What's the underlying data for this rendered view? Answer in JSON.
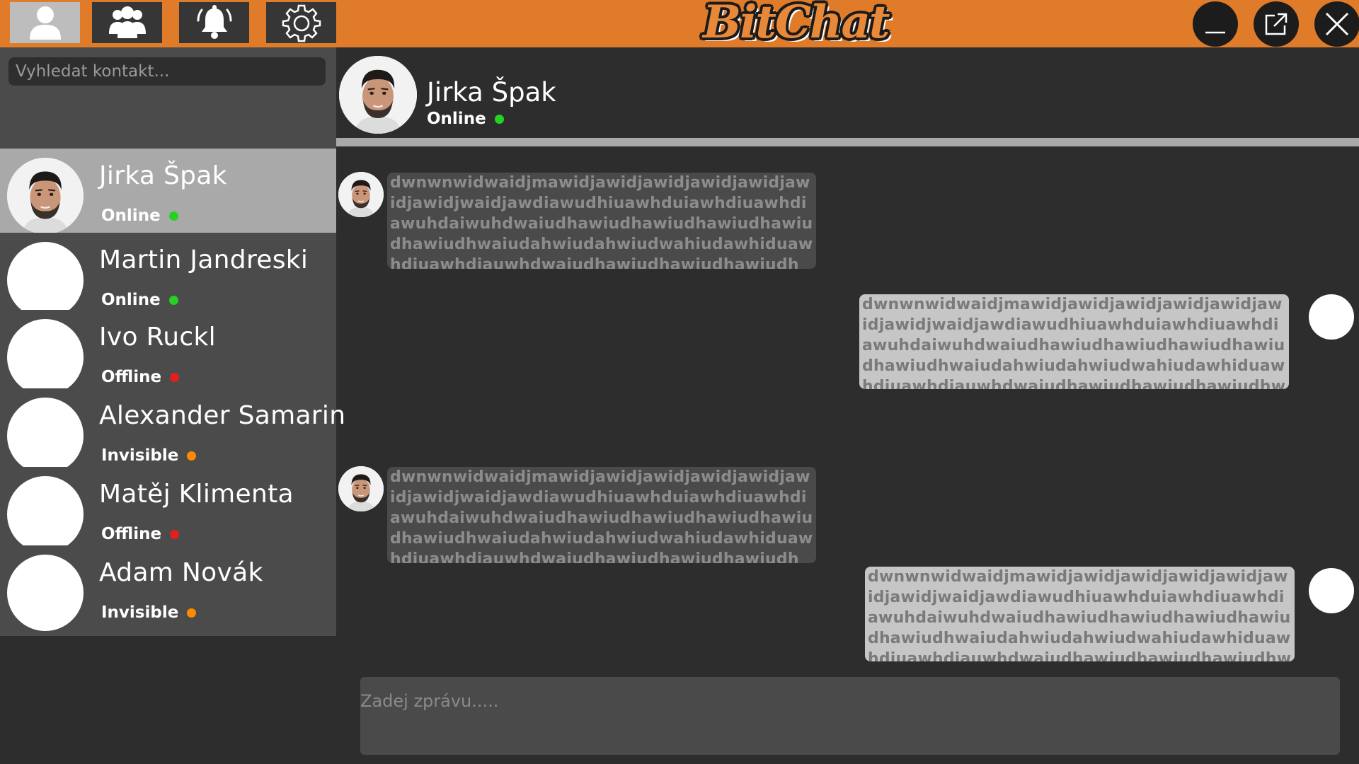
{
  "app": {
    "logo": "BitChat",
    "brand_color": "#e07b2a"
  },
  "topbar": {
    "nav": [
      {
        "icon": "user-icon",
        "active": true
      },
      {
        "icon": "group-icon",
        "active": false
      },
      {
        "icon": "bell-icon",
        "active": false
      },
      {
        "icon": "gear-icon",
        "active": false
      }
    ],
    "window_controls": [
      "minimize-icon",
      "popout-icon",
      "close-icon"
    ]
  },
  "sidebar": {
    "search": {
      "placeholder": "Vyhledat kontakt...",
      "value": ""
    },
    "contacts": [
      {
        "name": "Jirka Špak",
        "status": "Online",
        "status_color": "#22d322",
        "active": true,
        "has_photo": true
      },
      {
        "name": "Martin Jandreski",
        "status": "Online",
        "status_color": "#22d322",
        "active": false,
        "has_photo": false
      },
      {
        "name": "Ivo Ruckl",
        "status": "Offline",
        "status_color": "#e01f1f",
        "active": false,
        "has_photo": false
      },
      {
        "name": "Alexander Samarin",
        "status": "Invisible",
        "status_color": "#ff8a00",
        "active": false,
        "has_photo": false
      },
      {
        "name": "Matěj Klimenta",
        "status": "Offline",
        "status_color": "#e01f1f",
        "active": false,
        "has_photo": false
      },
      {
        "name": "Adam Novák",
        "status": "Invisible",
        "status_color": "#ff8a00",
        "active": false,
        "has_photo": false
      }
    ]
  },
  "chat": {
    "header": {
      "name": "Jirka Špak",
      "status": "Online",
      "status_color": "#22d322"
    },
    "messages": [
      {
        "direction": "incoming",
        "text": "dwnwnwidwaidjmawidjawidjawidjawidjawidjawidjawidjwaidjawdiawudhiuawhduiawhdiuawhdiawuhdaiwuhdwaiudhawiudhawiudhawiudhawiudhawiudhwaiudahwiudahwiudwahiudawhiduawhdiuawhdiauwhdwaiudhawiudhawiudhawiudhwaiudhwaiuhaw"
      },
      {
        "direction": "outgoing",
        "text": "dwnwnwidwaidjmawidjawidjawidjawidjawidjawidjawidjwaidjawdiawudhiuawhduiawhdiuawhdiawuhdaiwuhdwaiudhawiudhawiudhawiudhawiudhawiudhwaiudahwiudahwiudwahiudawhiduawhdiuawhdiauwhdwaiudhawiudhawiudhawiudhwaiudhwaiuhaw"
      },
      {
        "direction": "incoming",
        "text": "dwnwnwidwaidjmawidjawidjawidjawidjawidjawidjawidjwaidjawdiawudhiuawhduiawhdiuawhdiawuhdaiwuhdwaiudhawiudhawiudhawiudhawiudhawiudhwaiudahwiudahwiudwahiudawhiduawhdiuawhdiauwhdwaiudhawiudhawiudhawiudhwaiudhwaiuhaw"
      },
      {
        "direction": "outgoing",
        "text": "dwnwnwidwaidjmawidjawidjawidjawidjawidjawidjawidjwaidjawdiawudhiuawhduiawhdiuawhdiawuhdaiwuhdwaiudhawiudhawiudhawiudhawiudhawiudhwaiudahwiudahwiudwahiudawhiduawhdiuawhdiauwhdwaiudhawiudhawiudhawiudhwaiudhwaiuhaw"
      }
    ],
    "composer": {
      "placeholder": "Zadej zprávu.....",
      "value": ""
    }
  }
}
